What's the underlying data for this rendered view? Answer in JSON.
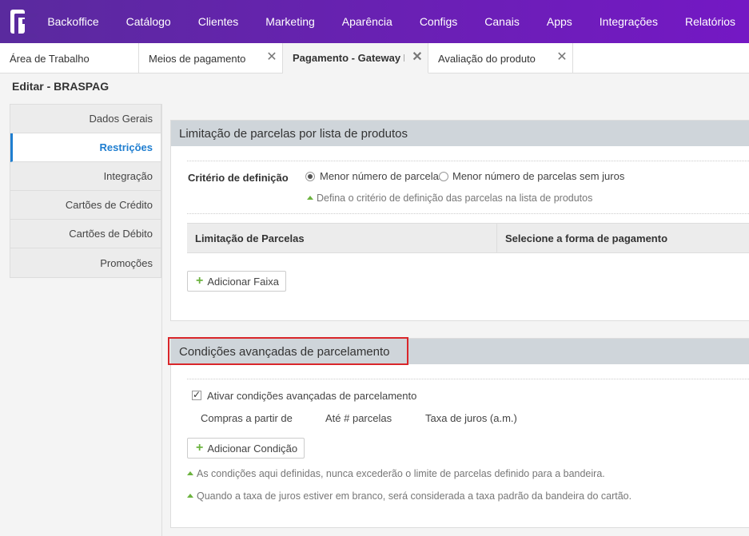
{
  "nav": {
    "items": [
      "Backoffice",
      "Catálogo",
      "Clientes",
      "Marketing",
      "Aparência",
      "Configs",
      "Canais",
      "Apps",
      "Integrações",
      "Relatórios"
    ]
  },
  "tabs": [
    {
      "label": "Área de Trabalho",
      "closable": false,
      "active": false
    },
    {
      "label": "Meios de pagamento",
      "closable": true,
      "active": false
    },
    {
      "label": "Pagamento - Gateway Br",
      "closable": true,
      "active": true
    },
    {
      "label": "Avaliação do produto",
      "closable": true,
      "active": false
    }
  ],
  "page": {
    "title": "Editar - BRASPAG"
  },
  "sidebar": {
    "items": [
      {
        "label": "Dados Gerais",
        "active": false
      },
      {
        "label": "Restrições",
        "active": true
      },
      {
        "label": "Integração",
        "active": false
      },
      {
        "label": "Cartões de Crédito",
        "active": false
      },
      {
        "label": "Cartões de Débito",
        "active": false
      },
      {
        "label": "Promoções",
        "active": false
      }
    ]
  },
  "limit_panel": {
    "title": "Limitação de parcelas por lista de produtos",
    "criteria_label": "Critério de definição",
    "option1": "Menor número de parcelas",
    "option2": "Menor número de parcelas sem juros",
    "selected": "option1",
    "hint": "Defina o critério de definição das parcelas na lista de produtos",
    "table_headers": [
      "Limitação de Parcelas",
      "Selecione a forma de pagamento"
    ],
    "add_button": "Adicionar Faixa"
  },
  "advanced_panel": {
    "title": "Condições avançadas de parcelamento",
    "checkbox_label": "Ativar condições avançadas de parcelamento",
    "checked": true,
    "columns": [
      "Compras a partir de",
      "Até # parcelas",
      "Taxa de juros (a.m.)"
    ],
    "add_button": "Adicionar Condição",
    "hint1": "As condições aqui definidas, nunca excederão o limite de parcelas definido para a bandeira.",
    "hint2": "Quando a taxa de juros estiver em branco, será considerada a taxa padrão da bandeira do cartão."
  },
  "colors": {
    "brand": "#6b1fb6",
    "accent": "#1f7ed0",
    "highlight": "#d9262a",
    "plus": "#6cb33f"
  }
}
